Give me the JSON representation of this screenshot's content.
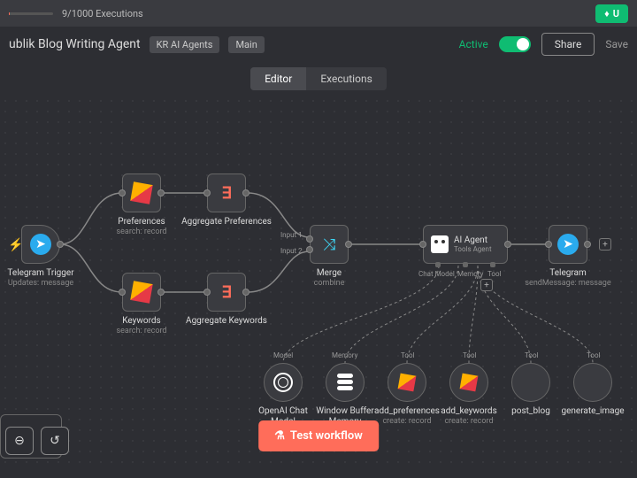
{
  "topbar": {
    "executions": "9/1000 Executions",
    "upgrade": "U"
  },
  "header": {
    "name": "ublik Blog Writing Agent",
    "tags": [
      "KR AI Agents",
      "Main"
    ],
    "active": "Active",
    "share": "Share",
    "save": "Save"
  },
  "tabs": {
    "editor": "Editor",
    "executions": "Executions"
  },
  "nodes": {
    "telegram_trigger": {
      "label": "Telegram Trigger",
      "sub": "Updates: message"
    },
    "preferences": {
      "label": "Preferences",
      "sub": "search: record"
    },
    "keywords": {
      "label": "Keywords",
      "sub": "search: record"
    },
    "agg_prefs": {
      "label": "Aggregate Preferences"
    },
    "agg_keys": {
      "label": "Aggregate Keywords"
    },
    "merge": {
      "label": "Merge",
      "sub": "combine",
      "input1": "Input 1",
      "input2": "Input 2"
    },
    "ai_agent": {
      "label": "AI Agent",
      "sub": "Tools Agent",
      "chat_model": "Chat Model",
      "memory": "Memory",
      "tool": "Tool"
    },
    "telegram": {
      "label": "Telegram",
      "sub": "sendMessage: message"
    },
    "tools": {
      "openai": {
        "label": "OpenAI Chat Model",
        "cat": "Model"
      },
      "buffer": {
        "label": "Window Buffer Memory",
        "cat": "Memory"
      },
      "add_prefs": {
        "label": "add_preferences",
        "sub": "create: record",
        "cat": "Tool"
      },
      "add_keys": {
        "label": "add_keywords",
        "sub": "create: record",
        "cat": "Tool"
      },
      "post_blog": {
        "label": "post_blog",
        "cat": "Tool"
      },
      "gen_img": {
        "label": "generate_image",
        "cat": "Tool"
      }
    }
  },
  "test_workflow": "Test workflow"
}
